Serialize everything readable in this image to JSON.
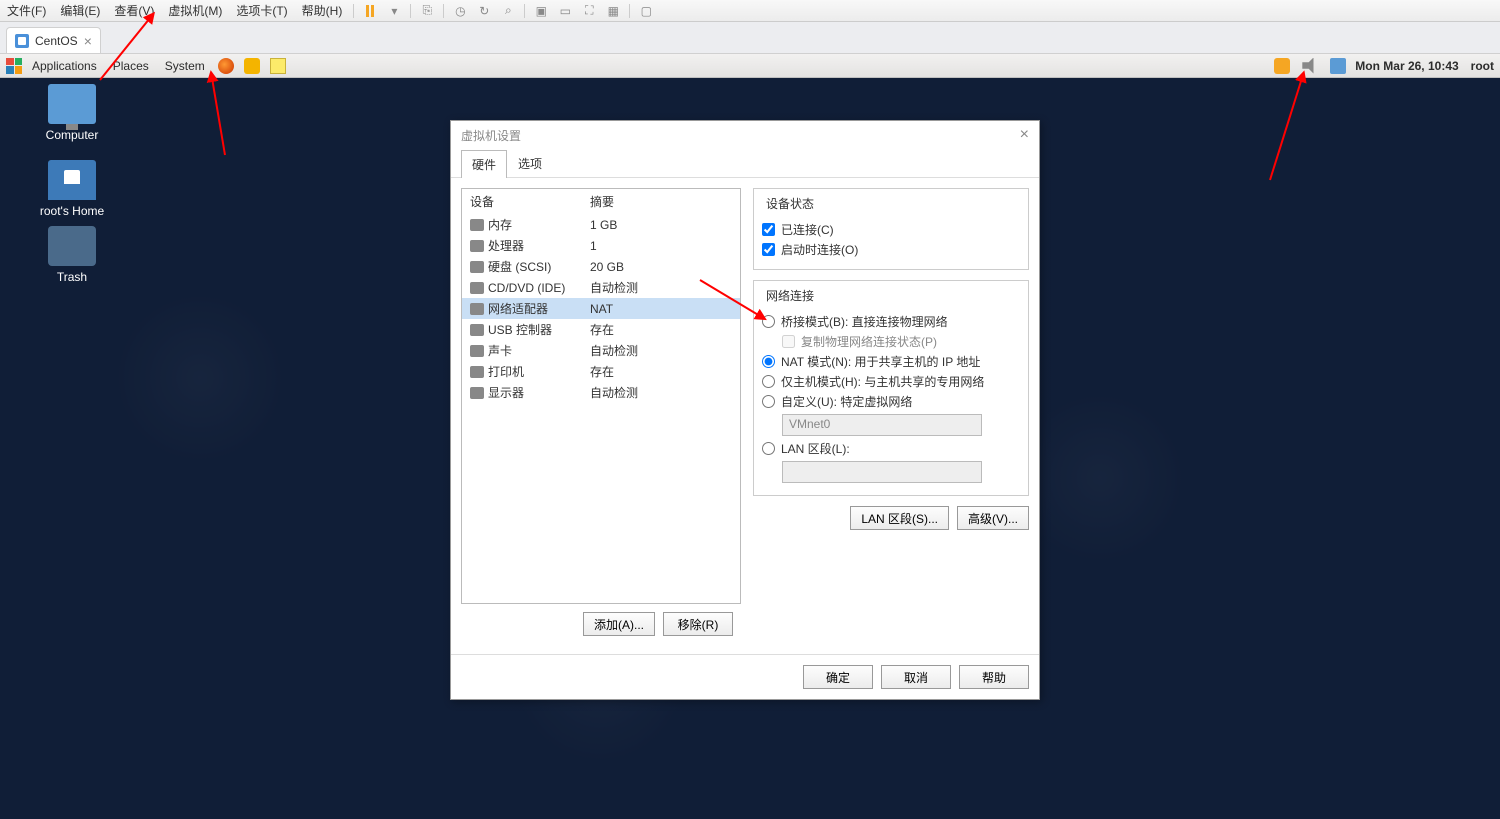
{
  "vmware_menu": {
    "file": "文件(F)",
    "edit": "编辑(E)",
    "view": "查看(V)",
    "vm": "虚拟机(M)",
    "tabs": "选项卡(T)",
    "help": "帮助(H)"
  },
  "tab": {
    "name": "CentOS"
  },
  "gnome": {
    "applications": "Applications",
    "places": "Places",
    "system": "System",
    "clock": "Mon Mar 26, 10:43",
    "user": "root"
  },
  "desktop": {
    "computer": "Computer",
    "home": "root's Home",
    "trash": "Trash"
  },
  "dialog": {
    "title": "虚拟机设置",
    "tab_hardware": "硬件",
    "tab_options": "选项",
    "col_device": "设备",
    "col_summary": "摘要",
    "devices": [
      {
        "name": "内存",
        "summary": "1 GB"
      },
      {
        "name": "处理器",
        "summary": "1"
      },
      {
        "name": "硬盘 (SCSI)",
        "summary": "20 GB"
      },
      {
        "name": "CD/DVD (IDE)",
        "summary": "自动检测"
      },
      {
        "name": "网络适配器",
        "summary": "NAT",
        "selected": true
      },
      {
        "name": "USB 控制器",
        "summary": "存在"
      },
      {
        "name": "声卡",
        "summary": "自动检测"
      },
      {
        "name": "打印机",
        "summary": "存在"
      },
      {
        "name": "显示器",
        "summary": "自动检测"
      }
    ],
    "add_btn": "添加(A)...",
    "remove_btn": "移除(R)",
    "state_legend": "设备状态",
    "connected": "已连接(C)",
    "connect_poweron": "启动时连接(O)",
    "net_legend": "网络连接",
    "bridged": "桥接模式(B): 直接连接物理网络",
    "replicate": "复制物理网络连接状态(P)",
    "nat": "NAT 模式(N): 用于共享主机的 IP 地址",
    "hostonly": "仅主机模式(H): 与主机共享的专用网络",
    "custom": "自定义(U): 特定虚拟网络",
    "custom_combo": "VMnet0",
    "lansegment": "LAN 区段(L):",
    "lan_btn": "LAN 区段(S)...",
    "adv_btn": "高级(V)...",
    "ok": "确定",
    "cancel": "取消",
    "help": "帮助"
  }
}
